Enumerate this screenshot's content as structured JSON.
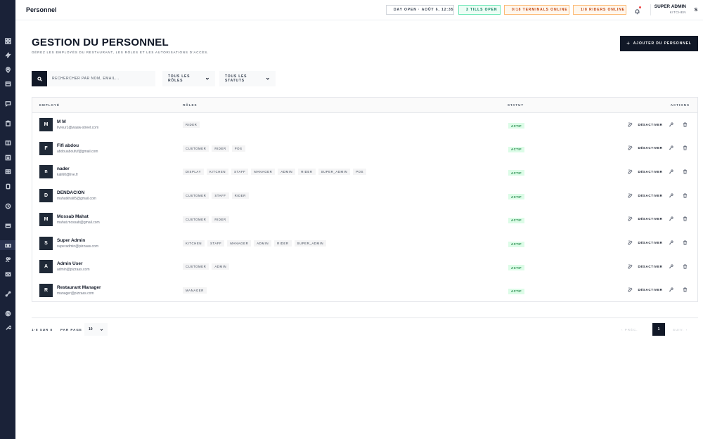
{
  "app": {
    "title": "Personnel"
  },
  "topbar": {
    "day_status": "DAY OPEN · AOÛT 6, 12:35",
    "tills": "3 TILLS OPEN",
    "terminals": "0/18 TERMINALS ONLINE",
    "riders": "1/8 RIDERS ONLINE",
    "user_name": "SUPER ADMIN",
    "user_role": "KITCHEN",
    "user_initial": "S"
  },
  "header": {
    "title": "GESTION DU PERSONNEL",
    "subtitle": "GÉREZ LES EMPLOYÉS DU RESTAURANT, LES RÔLES ET LES AUTORISATIONS D'ACCÈS.",
    "add_button": "AJOUTER DU PERSONNEL"
  },
  "filters": {
    "search_placeholder": "RECHERCHER PAR NOM, EMAIL...",
    "roles_select": "TOUS LES RÔLES",
    "status_select": "TOUS LES STATUTS"
  },
  "table": {
    "columns": {
      "employee": "EMPLOYÉ",
      "roles": "RÔLES",
      "status": "STATUT",
      "actions": "ACTIONS"
    },
    "deactivate_label": "DÉSACTIVER",
    "rows": [
      {
        "initial": "M",
        "name": "M M",
        "email": "livreur1@waaw-street.com",
        "roles": [
          "RIDER"
        ],
        "status": "ACTIF"
      },
      {
        "initial": "F",
        "name": "Fifi abdou",
        "email": "abdouaboufuf@gmail.com",
        "roles": [
          "CUSTOMER",
          "RIDER",
          "POS"
        ],
        "status": "ACTIF"
      },
      {
        "initial": "n",
        "name": "nader",
        "email": "kali60@live.fr",
        "roles": [
          "DISPLAY",
          "KITCHEN",
          "STAFF",
          "MANAGER",
          "ADMIN",
          "RIDER",
          "SUPER_ADMIN",
          "POS"
        ],
        "status": "ACTIF"
      },
      {
        "initial": "D",
        "name": "DENDACION",
        "email": "mahatkhalil5@gmail.com",
        "roles": [
          "CUSTOMER",
          "STAFF",
          "RIDER"
        ],
        "status": "ACTIF"
      },
      {
        "initial": "M",
        "name": "Mossab Mahat",
        "email": "mahat.mossab@gmail.com",
        "roles": [
          "CUSTOMER",
          "RIDER"
        ],
        "status": "ACTIF"
      },
      {
        "initial": "S",
        "name": "Super Admin",
        "email": "superadmin@pizzaas.com",
        "roles": [
          "KITCHEN",
          "STAFF",
          "MANAGER",
          "ADMIN",
          "RIDER",
          "SUPER_ADMIN"
        ],
        "status": "ACTIF"
      },
      {
        "initial": "A",
        "name": "Admin User",
        "email": "admin@pizzaas.com",
        "roles": [
          "CUSTOMER",
          "ADMIN"
        ],
        "status": "ACTIF"
      },
      {
        "initial": "R",
        "name": "Restaurant Manager",
        "email": "manager@pizzaas.com",
        "roles": [
          "MANAGER"
        ],
        "status": "ACTIF"
      }
    ]
  },
  "pagination": {
    "count": "1-8 SUR 8",
    "per_page_label": "PAR PAGE",
    "per_page_value": "10",
    "prev": "‹  PRÉC.",
    "current_page": "1",
    "next": "SUIV.  ›"
  },
  "sidebar": {
    "icons": [
      "dashboard-icon",
      "bolt-icon",
      "location-icon",
      "box-icon",
      "chat-icon",
      "clipboard-icon",
      "book-icon",
      "list-icon",
      "table-icon",
      "document-icon",
      "clock-icon",
      "card-icon",
      "cash-icon",
      "users-icon",
      "mail-icon",
      "route-icon",
      "settings-icon",
      "wrench-icon"
    ],
    "active_icon": "cash-icon"
  },
  "colors": {
    "sidebar": "#1a2238",
    "primary": "#111827",
    "tills_accent": "#047857",
    "online_accent": "#c2410c",
    "status_active": "#15803d"
  }
}
